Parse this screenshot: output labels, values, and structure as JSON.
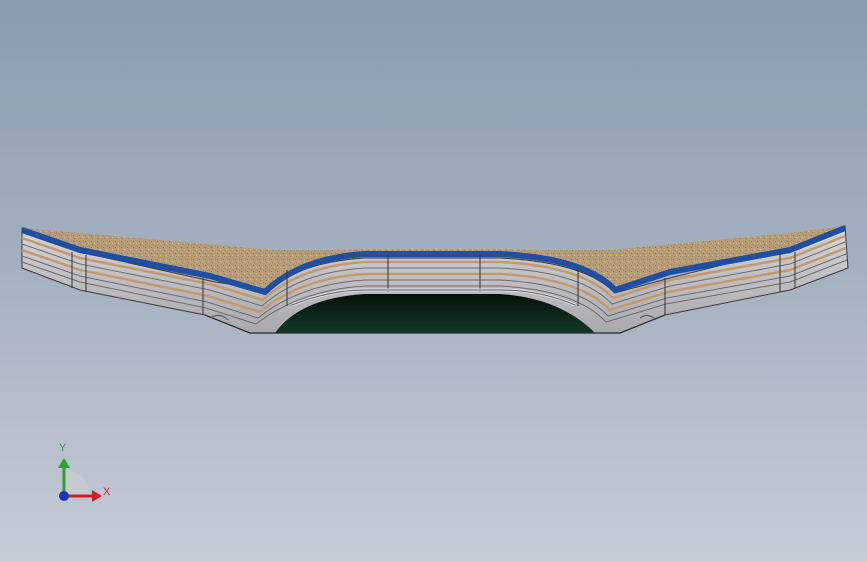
{
  "viewport": {
    "background_top": "#8b9bb0",
    "background_bottom": "#c6ccd6"
  },
  "model": {
    "top_surface_color": "#b79c78",
    "blue_layer_color": "#1f4fa3",
    "tan_layer_color": "#c39a6e",
    "gray_layer_color": "#c9c9cc",
    "cavity_color": "#0c2418"
  },
  "triad": {
    "y_label": "Y",
    "x_label": "X",
    "y_color": "#2fa12f",
    "x_color": "#cc2222",
    "z_color": "#2233bb"
  }
}
